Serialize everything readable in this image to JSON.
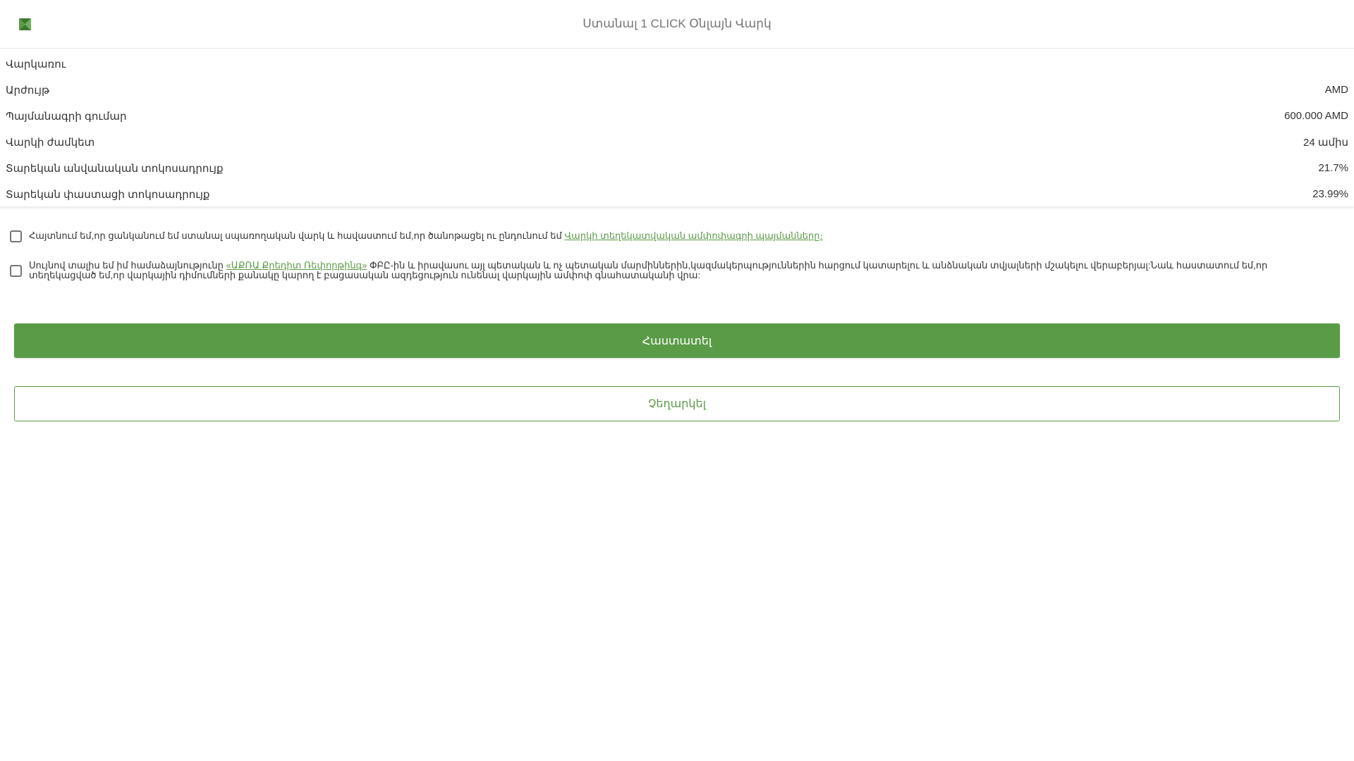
{
  "header": {
    "title": "Ստանալ 1 CLICK Օնլայն Վարկ",
    "logo_icon": "bank-logo-icon"
  },
  "details": {
    "rows": [
      {
        "label": "Վարկառու",
        "value": ""
      },
      {
        "label": "Արժույթ",
        "value": "AMD"
      },
      {
        "label": "Պայմանագրի գումար",
        "value": "600.000 AMD"
      },
      {
        "label": "Վարկի ժամկետ",
        "value": "24 ամիս"
      },
      {
        "label": "Տարեկան անվանական տոկոսադրույք",
        "value": "21.7%"
      },
      {
        "label": "Տարեկան փաստացի տոկոսադրույք",
        "value": "23.99%"
      }
    ]
  },
  "consents": {
    "first": {
      "text": "Հայտնում եմ,որ ցանկանում եմ ստանալ սպառողական վարկ և հավաստում եմ,որ ծանոթացել ու ընդունում եմ ",
      "link": "Վարկի տեղեկատվական ամփոփագրի պայմանները։",
      "checked": false
    },
    "second": {
      "text_before": "Սույնով տալիս եմ իմ համաձայնությունը ",
      "link": "«ԱՔՌԱ Քրեդիտ Ռեփորթինգ»",
      "text_after": " ՓԲԸ-ին և իրավասու այլ պետական և ոչ պետական մարմիններին,կազմակերպություններին հարցում կատարելու և անձնական տվյալների մշակելու վերաբերյալ:Նաև հաստատում եմ,որ տեղեկացված եմ,որ վարկային դիմումների քանակը կարող է բացասական ազդեցություն ունենալ վարկային ամփոփ գնահատականի վրա:",
      "checked": false
    }
  },
  "actions": {
    "confirm_label": "Հաստատել",
    "cancel_label": "Չեղարկել"
  },
  "colors": {
    "accent": "#5a9b47",
    "text": "#333333",
    "muted": "#757575"
  }
}
